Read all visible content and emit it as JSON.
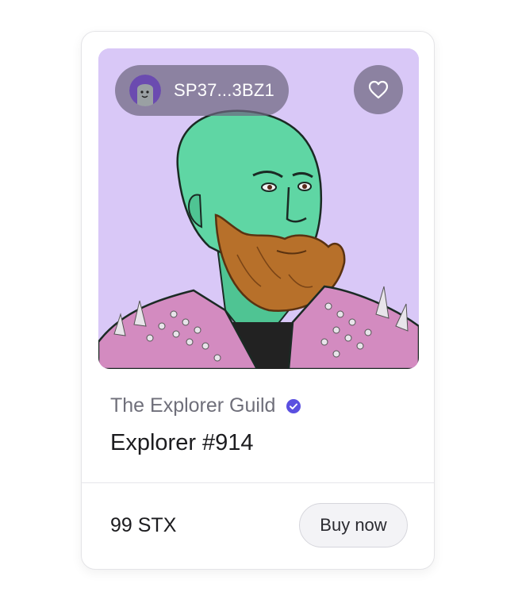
{
  "card": {
    "owner": {
      "address": "SP37...3BZ1",
      "avatar_icon": "ghost-avatar-icon"
    },
    "favorite": {
      "icon": "heart-icon"
    },
    "artwork": {
      "background_color": "#d9c8f7",
      "skin_color": "#5fd6a4",
      "beard_color": "#b7702a",
      "jacket_color": "#d38bc0"
    },
    "collection": {
      "name": "The Explorer Guild",
      "verified_icon": "verified-badge-icon",
      "verified_color": "#5a4fe0"
    },
    "item": {
      "name": "Explorer #914"
    },
    "listing": {
      "price": "99 STX",
      "buy_label": "Buy now"
    }
  }
}
